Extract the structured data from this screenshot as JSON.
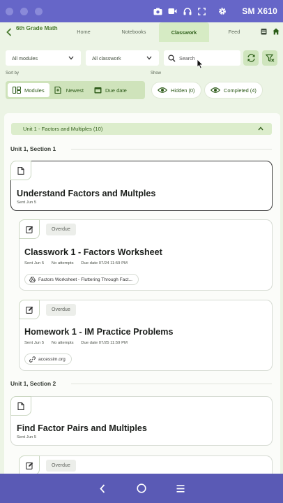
{
  "window": {
    "device_name": "SM X610",
    "toolbar_icons": [
      "camera-icon",
      "video-icon",
      "headphones-icon",
      "fullscreen-icon",
      "gear-icon"
    ]
  },
  "header": {
    "course": "6th Grade Math",
    "tabs": [
      {
        "label": "Home"
      },
      {
        "label": "Notebooks"
      },
      {
        "label": "Classwork"
      },
      {
        "label": "Feed"
      }
    ],
    "active_tab": "Classwork"
  },
  "filters": {
    "modules_select": "All modules",
    "classwork_select": "All classwork",
    "search_placeholder": "Search"
  },
  "sort": {
    "label": "Sort by",
    "options": [
      "Modules",
      "Newest",
      "Due date"
    ],
    "selected": "Modules"
  },
  "show": {
    "label": "Show",
    "hidden": "Hidden (0)",
    "completed": "Completed (4)"
  },
  "unit": {
    "title": "Unit 1 - Factors and Multiples (10)"
  },
  "sections": [
    {
      "title": "Unit 1, Section 1"
    },
    {
      "title": "Unit 1, Section 2"
    }
  ],
  "cards": [
    {
      "title": "Understand Factors and Multples",
      "sent": "Sent Jun 5",
      "icon": "document-icon"
    },
    {
      "badge": "Overdue",
      "title": "Classwork 1 - Factors Worksheet",
      "sent": "Sent Jun 5",
      "attempts": "No attempts",
      "due": "Due date 07/24 11:59 PM",
      "attachment": "Factors Worksheet - Fluttering Through Fact...",
      "icon": "edit-icon"
    },
    {
      "badge": "Overdue",
      "title": "Homework 1 - IM Practice Problems",
      "sent": "Sent Jun 5",
      "attempts": "No attempts",
      "due": "Due date 07/25 11:59 PM",
      "attachment": "accessim.org",
      "icon": "edit-icon"
    },
    {
      "title": "Find Factor Pairs and Multiples",
      "sent": "Sent Jun 5",
      "icon": "document-icon"
    },
    {
      "badge": "Overdue",
      "icon": "edit-icon"
    }
  ],
  "colors": {
    "titlebar": "#6666c8",
    "navbar": "#5a5ab5",
    "accent_green": "#47792d",
    "app_bg": "#ecf4e5"
  }
}
